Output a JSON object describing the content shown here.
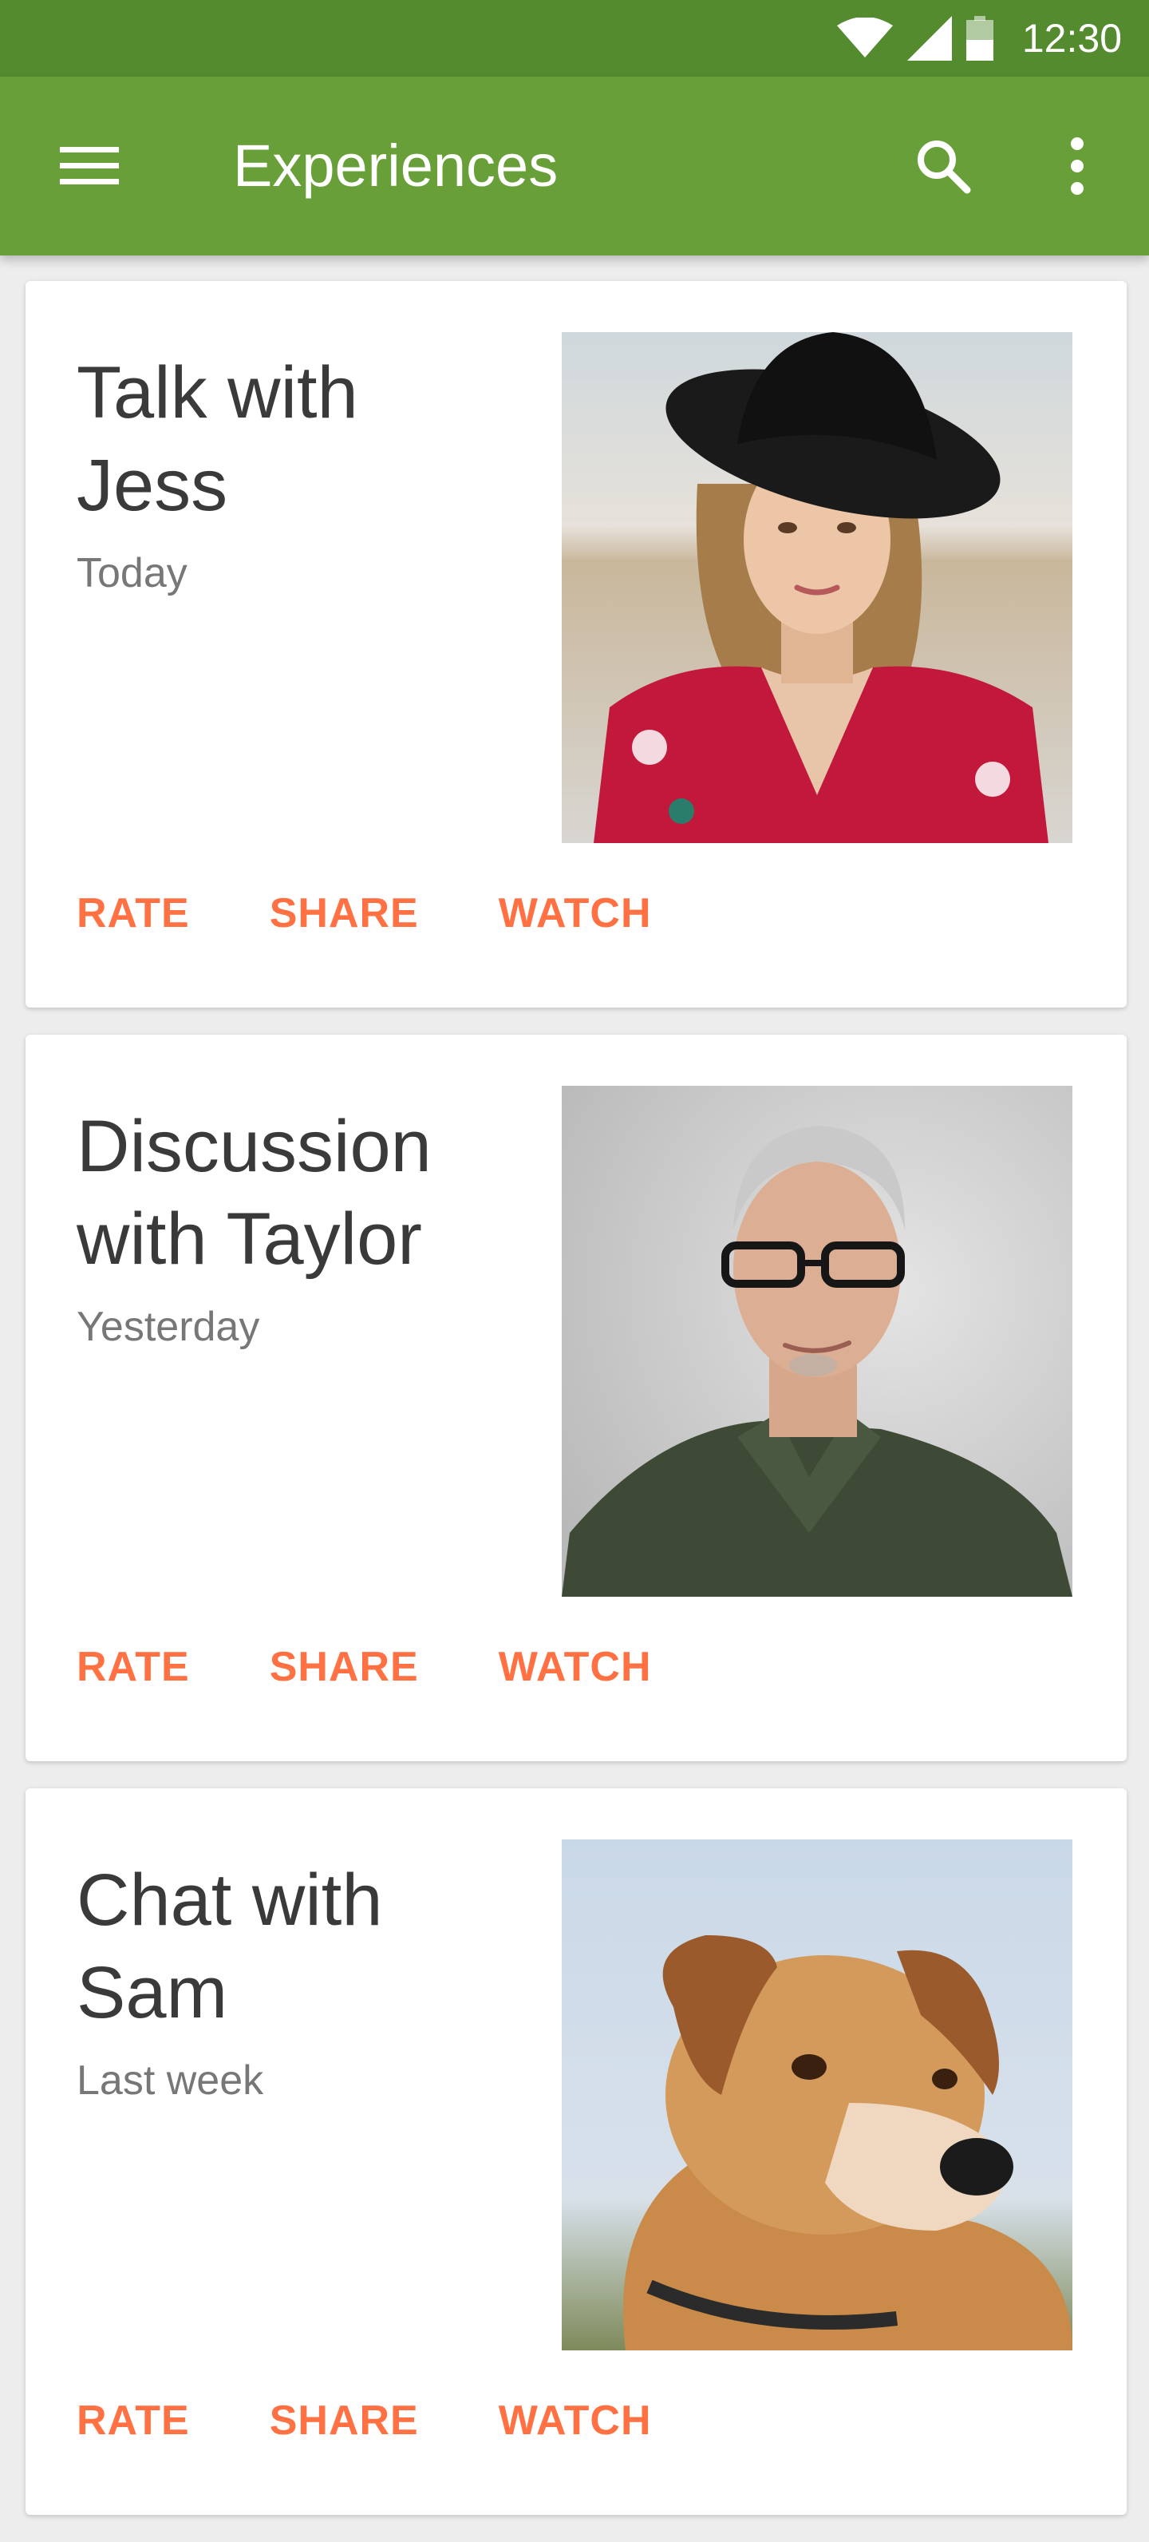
{
  "status_bar": {
    "time": "12:30",
    "icons": [
      "wifi-icon",
      "cellular-signal-icon",
      "battery-icon"
    ]
  },
  "app_bar": {
    "title": "Experiences",
    "menu_icon": "hamburger-menu-icon",
    "search_icon": "search-icon",
    "more_icon": "more-vert-icon"
  },
  "colors": {
    "status_bar": "#558b2f",
    "app_bar": "#689f38",
    "accent": "#ff7043",
    "background": "#ededed"
  },
  "cards": [
    {
      "title_line1": "Talk with",
      "title_line2": "Jess",
      "subtitle": "Today",
      "photo": "portrait-woman-hat",
      "actions": [
        "RATE",
        "SHARE",
        "WATCH"
      ]
    },
    {
      "title_line1": "Discussion",
      "title_line2": "with Taylor",
      "subtitle": "Yesterday",
      "photo": "portrait-man-glasses",
      "actions": [
        "RATE",
        "SHARE",
        "WATCH"
      ]
    },
    {
      "title_line1": "Chat with",
      "title_line2": "Sam",
      "subtitle": "Last week",
      "photo": "dog-portrait",
      "actions": [
        "RATE",
        "SHARE",
        "WATCH"
      ]
    }
  ]
}
